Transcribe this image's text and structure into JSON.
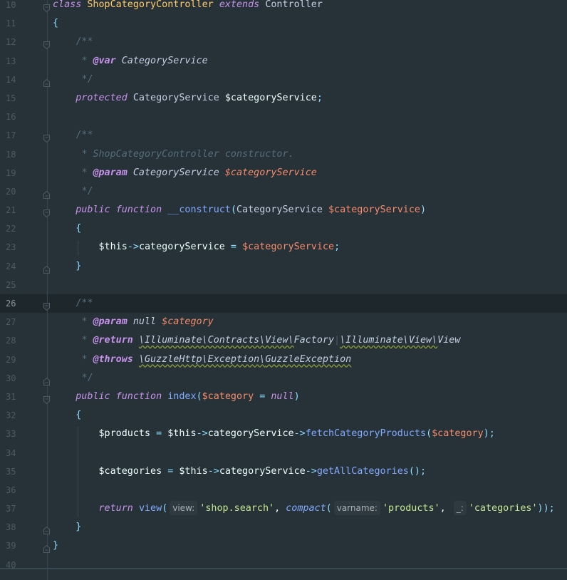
{
  "editor": {
    "current_line": 26,
    "lines": [
      {
        "n": "10",
        "fold": "open"
      },
      {
        "n": "11"
      },
      {
        "n": "12",
        "fold": "open"
      },
      {
        "n": "13"
      },
      {
        "n": "14",
        "fold": "close"
      },
      {
        "n": "15"
      },
      {
        "n": "16"
      },
      {
        "n": "17",
        "fold": "open"
      },
      {
        "n": "18"
      },
      {
        "n": "19"
      },
      {
        "n": "20",
        "fold": "close"
      },
      {
        "n": "21",
        "fold": "open"
      },
      {
        "n": "22"
      },
      {
        "n": "23"
      },
      {
        "n": "24",
        "fold": "close"
      },
      {
        "n": "25"
      },
      {
        "n": "26",
        "fold": "open"
      },
      {
        "n": "27"
      },
      {
        "n": "28"
      },
      {
        "n": "29"
      },
      {
        "n": "30",
        "fold": "close"
      },
      {
        "n": "31",
        "fold": "open"
      },
      {
        "n": "32"
      },
      {
        "n": "33"
      },
      {
        "n": "34"
      },
      {
        "n": "35"
      },
      {
        "n": "36"
      },
      {
        "n": "37"
      },
      {
        "n": "38",
        "fold": "close"
      },
      {
        "n": "39",
        "fold": "close"
      },
      {
        "n": "40"
      }
    ],
    "tokens": {
      "l10": {
        "class": "class",
        "name": "ShopCategoryController",
        "extends": "extends",
        "parent": "Controller"
      },
      "l11": {
        "brace": "{"
      },
      "l12": {
        "open": "/**"
      },
      "l13": {
        "star": "* ",
        "tag": "@var",
        "type": "CategoryService"
      },
      "l14": {
        "close": "*/"
      },
      "l15": {
        "mod": "protected",
        "type": "CategoryService",
        "var": "$categoryService",
        "semi": ";"
      },
      "l17": {
        "open": "/**"
      },
      "l18": {
        "star": "* ",
        "text": "ShopCategoryController constructor."
      },
      "l19": {
        "star": "* ",
        "tag": "@param",
        "type": "CategoryService",
        "var": "$categoryService"
      },
      "l20": {
        "close": "*/"
      },
      "l21": {
        "mod": "public",
        "fn_kw": "function",
        "name": "__construct",
        "lp": "(",
        "type": "CategoryService",
        "var": "$categoryService",
        "rp": ")"
      },
      "l22": {
        "brace": "{"
      },
      "l23": {
        "this": "$this",
        "arrow": "->",
        "prop": "categoryService",
        "eq": " = ",
        "var": "$categoryService",
        "semi": ";"
      },
      "l24": {
        "brace": "}"
      },
      "l26": {
        "open": "/**"
      },
      "l27": {
        "star": "* ",
        "tag": "@param",
        "type": "null",
        "var": "$category"
      },
      "l28": {
        "star": "* ",
        "tag": "@return",
        "ns1": "\\Illuminate\\Contracts\\View\\",
        "t1": "Factory",
        "sep": "|",
        "ns2": "\\Illuminate\\View\\",
        "t2": "View"
      },
      "l29": {
        "star": "* ",
        "tag": "@throws",
        "ns": "\\GuzzleHttp\\Exception\\",
        "t": "GuzzleException"
      },
      "l30": {
        "close": "*/"
      },
      "l31": {
        "mod": "public",
        "fn_kw": "function",
        "name": "index",
        "lp": "(",
        "var": "$category",
        "eq": " = ",
        "null": "null",
        "rp": ")"
      },
      "l32": {
        "brace": "{"
      },
      "l33": {
        "var": "$products",
        "eq": " = ",
        "this": "$this",
        "arrow": "->",
        "prop": "categoryService",
        "arrow2": "->",
        "method": "fetchCategoryProducts",
        "lp": "(",
        "arg": "$category",
        "rp": ")",
        "semi": ";"
      },
      "l35": {
        "var": "$categories",
        "eq": " = ",
        "this": "$this",
        "arrow": "->",
        "prop": "categoryService",
        "arrow2": "->",
        "method": "getAllCategories",
        "parens": "()",
        "semi": ";"
      },
      "l37": {
        "ret": "return",
        "fn": "view",
        "lp": "(",
        "hint1": "view:",
        "str1": "'shop.search'",
        "comma": ", ",
        "fn2": "compact",
        "lp2": "(",
        "hint2": "varname:",
        "str2": "'products'",
        "comma2": ", ",
        "hint3": "_:",
        "str3": "'categories'",
        "rp": "))",
        "semi": ";"
      },
      "l38": {
        "brace": "}"
      },
      "l39": {
        "brace": "}"
      }
    }
  }
}
